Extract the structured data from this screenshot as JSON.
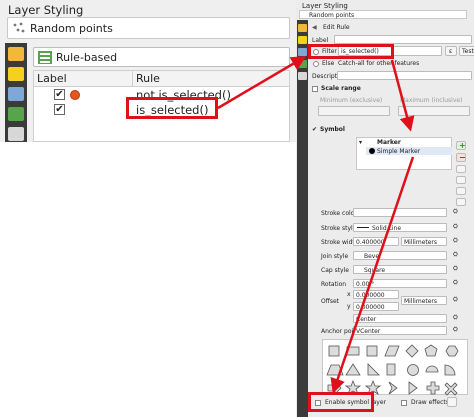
{
  "left": {
    "title": "Layer Styling",
    "layer_name": "Random points",
    "renderer": "Rule-based",
    "table": {
      "headers": [
        "Label",
        "Rule"
      ],
      "rows": [
        {
          "checked": true,
          "rule": "not is_selected()",
          "symbol_color": "#e8541c"
        },
        {
          "checked": true,
          "rule": "is_selected()"
        }
      ]
    }
  },
  "right": {
    "title": "Layer Styling",
    "layer_name": "Random points",
    "edit_rule": "Edit Rule",
    "label_label": "Label",
    "filter_label": "Filter",
    "filter_value": "is_selected()",
    "epsilon_button": "ε",
    "test_button": "Test",
    "else_label": "Else",
    "else_desc": "Catch-all for other features",
    "description_label": "Description",
    "scale_range_label": "Scale range",
    "min_label": "Minimum (exclusive)",
    "max_label": "Maximum (inclusive)",
    "symbol_label": "Symbol",
    "tree_marker": "Marker",
    "tree_simple_marker": "Simple Marker",
    "props": [
      {
        "label": "Stroke color",
        "value": ""
      },
      {
        "label": "Stroke style",
        "value": "Solid Line"
      },
      {
        "label": "Stroke width",
        "value": "0.400000",
        "unit": "Millimeters"
      },
      {
        "label": "Join style",
        "value": "Bevel"
      },
      {
        "label": "Cap style",
        "value": "Square"
      },
      {
        "label": "Rotation",
        "value": "0.00 °"
      },
      {
        "label": "Offset",
        "x_label": "x",
        "y_label": "y",
        "x": "0.000000",
        "y": "0.000000",
        "unit": "Millimeters"
      },
      {
        "label": "",
        "value": "Center"
      },
      {
        "label": "Anchor point",
        "value": "VCenter"
      }
    ],
    "enable_symbol_layer": "Enable symbol layer",
    "draw_effects": "Draw effects"
  },
  "colors": {
    "highlight": "#e0101a",
    "sidebar": "#3b3b3b",
    "orange_dot": "#e8541c"
  }
}
